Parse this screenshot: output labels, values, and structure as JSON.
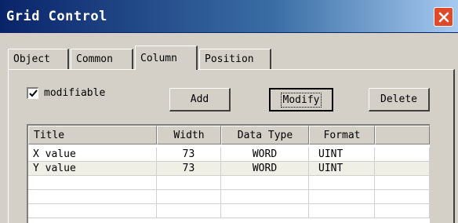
{
  "window": {
    "title": "Grid Control",
    "close_icon": "close-icon"
  },
  "tabs": [
    {
      "label": "Object",
      "active": false
    },
    {
      "label": "Common",
      "active": false
    },
    {
      "label": "Column",
      "active": true
    },
    {
      "label": "Position",
      "active": false
    }
  ],
  "options": {
    "modifiable_label": "modifiable",
    "modifiable_checked": true
  },
  "buttons": {
    "add": "Add",
    "modify": "Modify",
    "delete": "Delete"
  },
  "grid": {
    "columns": [
      "Title",
      "Width",
      "Data Type",
      "Format",
      ""
    ],
    "rows": [
      {
        "title": "X value",
        "width": "73",
        "data_type": "WORD",
        "format": "UINT"
      },
      {
        "title": "Y value",
        "width": "73",
        "data_type": "WORD",
        "format": "UINT"
      }
    ]
  }
}
